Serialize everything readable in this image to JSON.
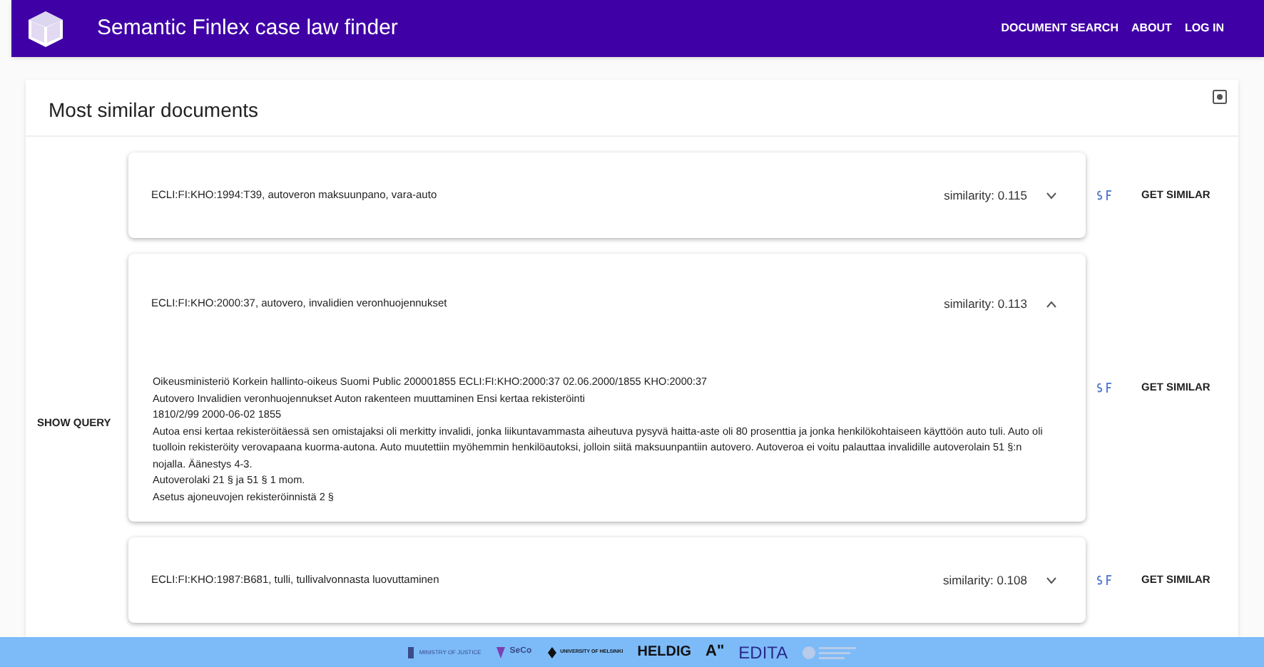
{
  "app_bar": {
    "title": "Semantic Finlex case law finder",
    "nav": [
      "DOCUMENT SEARCH",
      "ABOUT",
      "LOG IN"
    ]
  },
  "panel": {
    "title": "Most similar documents",
    "show_query": "SHOW QUERY",
    "results": [
      {
        "title": "ECLI:FI:KHO:1994:T39, autoveron maksuunpano, vara-auto",
        "similarity": "similarity: 0.115",
        "expanded": false,
        "action": "GET SIMILAR"
      },
      {
        "title": "ECLI:FI:KHO:2000:37, autovero, invalidien veronhuojennukset",
        "similarity": "similarity: 0.113",
        "expanded": true,
        "action": "GET SIMILAR",
        "body": [
          "Oikeusministeriö Korkein hallinto-oikeus Suomi Public 200001855 ECLI:FI:KHO:2000:37 02.06.2000/1855 KHO:2000:37",
          "Autovero Invalidien veronhuojennukset Auton rakenteen muuttaminen Ensi kertaa rekisteröinti",
          "1810/2/99 2000-06-02 1855",
          "Autoa ensi kertaa rekisteröitäessä sen omistajaksi oli merkitty invalidi, jonka liikuntavammasta aiheutuva pysyvä haitta-aste oli 80 prosenttia ja jonka henkilökohtaiseen käyttöön auto tuli. Auto oli tuolloin rekisteröity verovapaana kuorma-autona. Auto muutettiin myöhemmin henkilöautoksi, jolloin siitä maksuunpantiin autovero. Autoveroa ei voitu palauttaa invalidille autoverolain 51 §:n nojalla. Äänestys 4-3.",
          "Autoverolaki 21 § ja 51 § 1 mom.",
          "Asetus ajoneuvojen rekisteröinnistä 2 §"
        ]
      },
      {
        "title": "ECLI:FI:KHO:1987:B681, tulli, tullivalvonnasta luovuttaminen",
        "similarity": "similarity: 0.108",
        "expanded": false,
        "action": "GET SIMILAR"
      }
    ]
  },
  "footer": {
    "logos": [
      "MINISTRY OF JUSTICE",
      "SeCo",
      "UNIVERSITY OF HELSINKI",
      "HELDIG",
      "A\"",
      "EDITA"
    ]
  }
}
